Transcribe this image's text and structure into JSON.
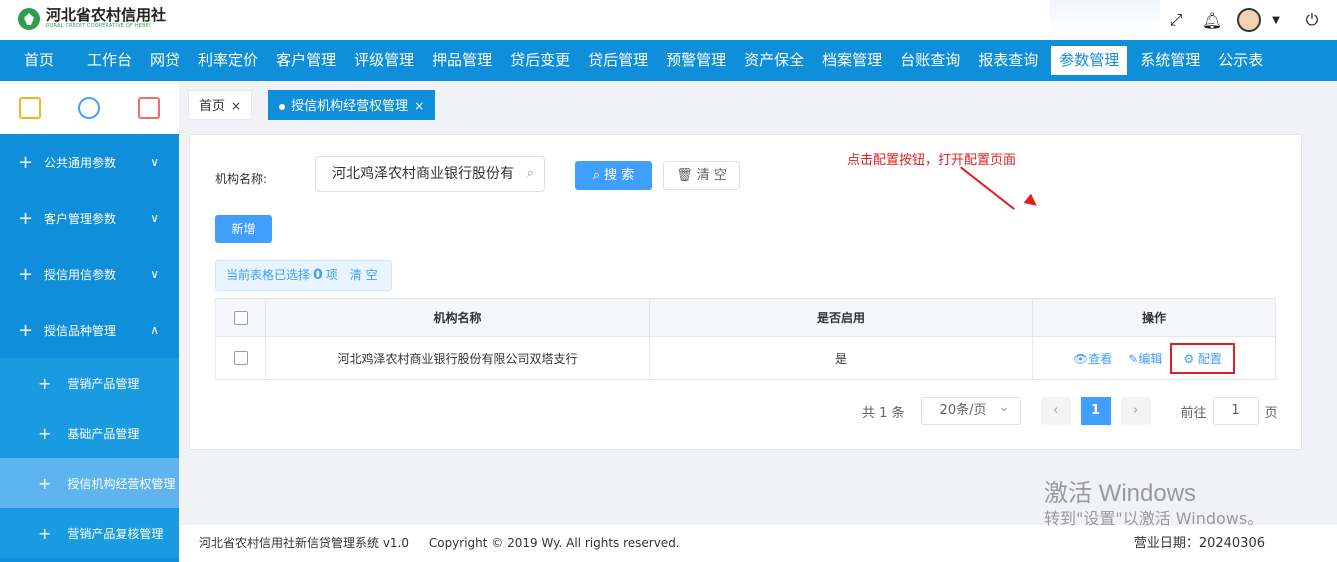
{
  "logo": {
    "name_cn": "河北省农村信用社",
    "name_en": "RURAL CREDIT COOPERATIVE OF HEBEI"
  },
  "nav": [
    "首页",
    "工作台",
    "网贷",
    "利率定价",
    "客户管理",
    "评级管理",
    "押品管理",
    "贷后变更",
    "贷后管理",
    "预警管理",
    "资产保全",
    "档案管理",
    "台账查询",
    "报表查询",
    "参数管理",
    "系统管理",
    "公示表"
  ],
  "nav_active_index": 14,
  "tabs": [
    {
      "label": "首页",
      "close": "×"
    },
    {
      "label": "授信机构经营权管理",
      "close": "×"
    }
  ],
  "sidebar": {
    "groups": [
      {
        "label": "公共通用参数",
        "chevron": "∨"
      },
      {
        "label": "客户管理参数",
        "chevron": "∨"
      },
      {
        "label": "授信用信参数",
        "chevron": "∨"
      },
      {
        "label": "授信品种管理",
        "chevron": "∧"
      }
    ],
    "subs": [
      {
        "label": "营销产品管理"
      },
      {
        "label": "基础产品管理"
      },
      {
        "label": "授信机构经营权管理"
      },
      {
        "label": "营销产品复核管理"
      }
    ]
  },
  "search": {
    "label": "机构名称:",
    "value": "河北鸡泽农村商业银行股份有",
    "search_btn": "搜 索",
    "clear_btn": "清 空"
  },
  "add_btn": "新增",
  "selection": {
    "prefix": "当前表格已选择",
    "count": "0",
    "suffix": "项",
    "clear": "清 空"
  },
  "table": {
    "headers": {
      "name": "机构名称",
      "enabled": "是否启用",
      "ops": "操作"
    },
    "rows": [
      {
        "name": "河北鸡泽农村商业银行股份有限公司双塔支行",
        "enabled": "是",
        "view": "查看",
        "edit": "编辑",
        "config": "配置"
      }
    ]
  },
  "annotation": "点击配置按钮，打开配置页面",
  "pager": {
    "total": "共 1 条",
    "size": "20条/页",
    "current": "1",
    "goto": "前往",
    "goto_value": "1",
    "page_suffix": "页"
  },
  "footer": {
    "system": "河北省农村信用社新信贷管理系统 v1.0",
    "copyright": "Copyright © 2019 Wy. All rights reserved.",
    "date": "营业日期：20240306"
  },
  "watermark": {
    "line1": "激活 Windows",
    "line2": "转到\"设置\"以激活 Windows。"
  },
  "colors": {
    "primary": "#0f8fd9",
    "button": "#409eff",
    "annotation": "#e02020"
  }
}
